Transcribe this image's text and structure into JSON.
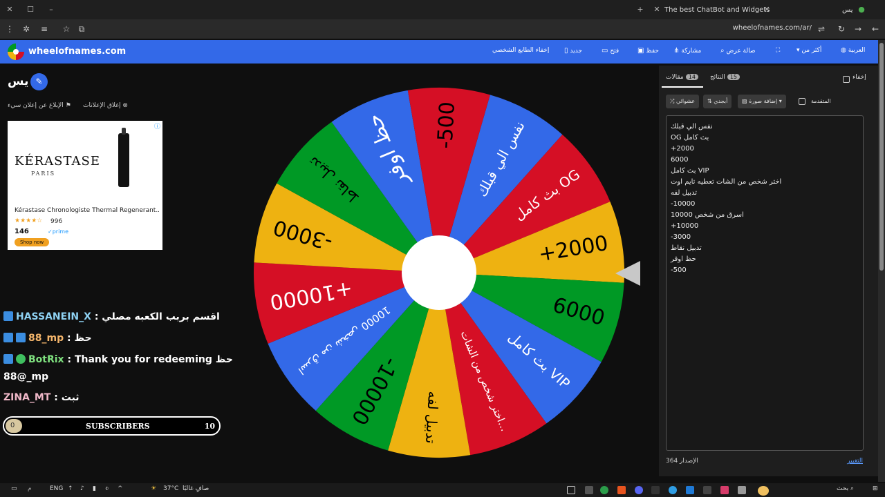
{
  "browser": {
    "tabs": [
      {
        "title": "The best ChatBot and Widgets"
      },
      {
        "title": "يس"
      }
    ],
    "url": "wheelofnames.com/ar/"
  },
  "header": {
    "brand": "wheelofnames.com",
    "nav": [
      "العربية",
      "أكثر من",
      "صالة عرض",
      "مشاركة",
      "حفظ",
      "فتح",
      "جديد",
      "إخفاء الطابع الشخصي"
    ]
  },
  "left": {
    "wheel_title": "يس",
    "ad_links": [
      "إغلاق الإعلانات",
      "الإبلاغ عن إعلان سيء"
    ],
    "ad": {
      "brand": "KÉRASTASE",
      "sub": "PARIS",
      "title": "Kérastase Chronologiste Thermal Regenerant...",
      "stars": "★★★★☆",
      "rating_count": "996",
      "price": "146",
      "prime": "✓prime",
      "shop": "Shop now"
    },
    "chat": [
      {
        "user": "HASSANEIN_X",
        "text": ": اقسم بربب الكعبه مصلي",
        "color": "#8fd3f4"
      },
      {
        "user": "88_mp",
        "text": ": حظ",
        "color": "#f4b56b"
      },
      {
        "user": "BotRix",
        "text": ": Thank you for redeeming حظ",
        "color": "#7ee07e"
      },
      {
        "user": "",
        "text": "88@_mp",
        "color": "#ffffff"
      },
      {
        "user": "ZINA_MT",
        "text": ": ثبت",
        "color": "#f0b8c8"
      }
    ],
    "subscribers": {
      "label": "SUBSCRIBERS",
      "current": "0",
      "goal": "10"
    }
  },
  "wheel": {
    "segments": [
      {
        "label": "نفس الي قبلك",
        "color": "#3369e8",
        "text_color": "#ffffff"
      },
      {
        "label": "بث كامل OG",
        "color": "#d50f25",
        "text_color": "#ffffff"
      },
      {
        "label": "+2000",
        "color": "#eeb211",
        "text_color": "#000000"
      },
      {
        "label": "6000",
        "color": "#009925",
        "text_color": "#000000"
      },
      {
        "label": "بث كامل VIP",
        "color": "#3369e8",
        "text_color": "#ffffff"
      },
      {
        "label": "اختر شخص من الشات...",
        "color": "#d50f25",
        "text_color": "#ffffff"
      },
      {
        "label": "تدبيل لفه",
        "color": "#eeb211",
        "text_color": "#000000"
      },
      {
        "label": "-10000",
        "color": "#009925",
        "text_color": "#000000"
      },
      {
        "label": "اسرق من شخص 10000",
        "color": "#3369e8",
        "text_color": "#ffffff"
      },
      {
        "label": "+10000",
        "color": "#d50f25",
        "text_color": "#ffffff"
      },
      {
        "label": "-3000",
        "color": "#eeb211",
        "text_color": "#000000"
      },
      {
        "label": "تدبيل نقاط",
        "color": "#009925",
        "text_color": "#000000"
      },
      {
        "label": "حظ اوفر",
        "color": "#3369e8",
        "text_color": "#ffffff"
      },
      {
        "label": "-500",
        "color": "#d50f25",
        "text_color": "#000000"
      }
    ]
  },
  "panel": {
    "hide_label": "إخفاء",
    "tab_entries": "مقالات",
    "tab_entries_count": "14",
    "tab_results": "النتائج",
    "tab_results_count": "15",
    "shuffle": "عشوائي",
    "sort": "أبجدي",
    "add_image": "إضافة صورة",
    "advanced": "المتقدمة",
    "entries": [
      "نفس الي قبلك",
      "OG بث كامل",
      "+2000",
      "6000",
      "بث كامل VIP",
      "اختر شخص من الشات تعطيه تايم اوت",
      "تدبيل لفه",
      "-10000",
      "اسرق من شخص 10000",
      "+10000",
      "-3000",
      "تدبيل نقاط",
      "حظ اوفر",
      "-500"
    ],
    "version": "الإصدار 364",
    "changes": "التغيير"
  },
  "taskbar": {
    "weather": "37°C",
    "weather_text": "صافٍ غالبًا",
    "lang": "ENG",
    "search": "بحث"
  }
}
